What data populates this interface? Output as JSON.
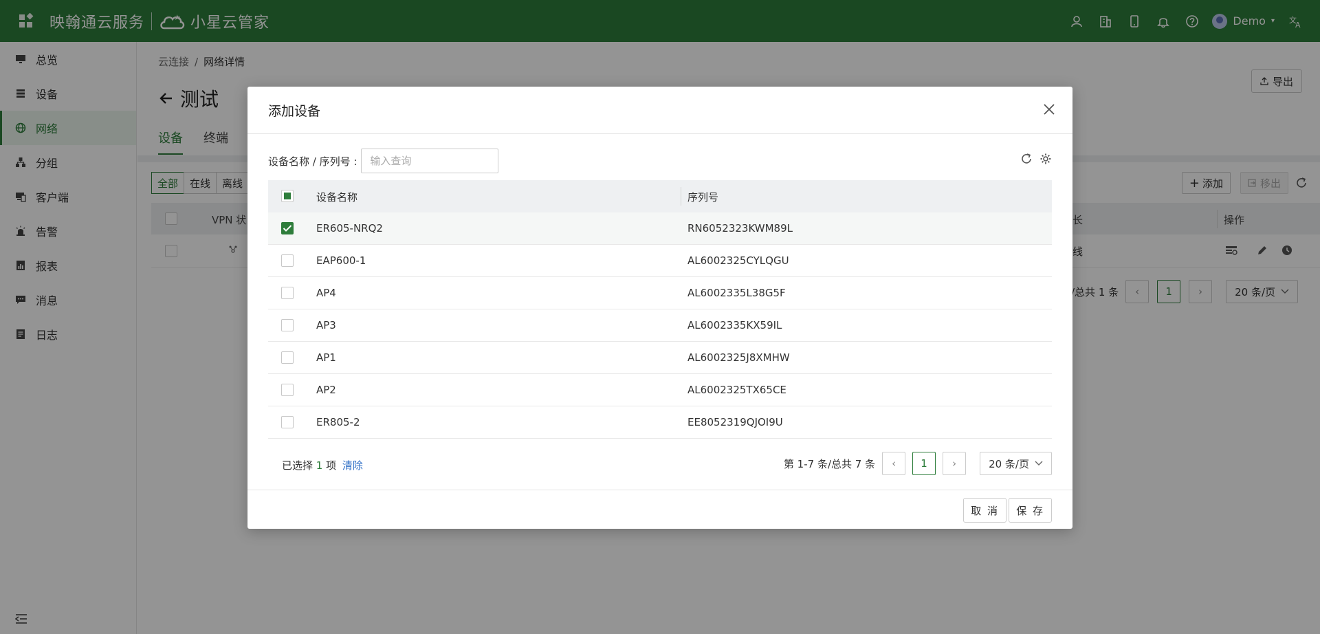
{
  "header": {
    "brand": "映翰通云服务",
    "product": "小星云管家",
    "user": "Demo",
    "icons": [
      "user-icon",
      "building-icon",
      "mobile-icon",
      "bell-icon",
      "help-icon",
      "translate-icon"
    ],
    "bg_color": "#2e7d3b"
  },
  "sidebar": {
    "items": [
      {
        "label": "总览",
        "icon": "monitor-icon"
      },
      {
        "label": "设备",
        "icon": "server-icon"
      },
      {
        "label": "网络",
        "icon": "globe-icon",
        "active": true
      },
      {
        "label": "分组",
        "icon": "hierarchy-icon"
      },
      {
        "label": "客户端",
        "icon": "client-icon"
      },
      {
        "label": "告警",
        "icon": "alarm-icon"
      },
      {
        "label": "报表",
        "icon": "report-icon"
      },
      {
        "label": "消息",
        "icon": "message-icon"
      },
      {
        "label": "日志",
        "icon": "log-icon"
      }
    ]
  },
  "main": {
    "breadcrumb": [
      "云连接",
      "网络详情"
    ],
    "title": "测试",
    "export_label": "导出",
    "tabs": [
      "设备",
      "终端"
    ],
    "filters": [
      "全部",
      "在线",
      "离线"
    ],
    "add_label": "添加",
    "remove_label": "移出",
    "table_headers": {
      "vpn": "VPN 状",
      "duration": "长",
      "actions": "操作"
    },
    "row_status": "线",
    "pager": {
      "summary": "/总共 1 条",
      "page": "1",
      "size": "20 条/页"
    }
  },
  "modal": {
    "title": "添加设备",
    "search_label": "设备名称 / 序列号 :",
    "search_placeholder": "输入查询",
    "columns": [
      "设备名称",
      "序列号"
    ],
    "rows": [
      {
        "name": "ER605-NRQ2",
        "serial": "RN6052323KWM89L",
        "checked": true
      },
      {
        "name": "EAP600-1",
        "serial": "AL6002325CYLQGU",
        "checked": false
      },
      {
        "name": "AP4",
        "serial": "AL6002335L38G5F",
        "checked": false
      },
      {
        "name": "AP3",
        "serial": "AL6002335KX59IL",
        "checked": false
      },
      {
        "name": "AP1",
        "serial": "AL6002325J8XMHW",
        "checked": false
      },
      {
        "name": "AP2",
        "serial": "AL6002325TX65CE",
        "checked": false
      },
      {
        "name": "ER805-2",
        "serial": "EE8052319QJOI9U",
        "checked": false
      }
    ],
    "selection": {
      "prefix": "已选择",
      "count": "1",
      "suffix": "项",
      "clear": "清除"
    },
    "pager": {
      "summary": "第 1-7 条/总共 7 条",
      "page": "1",
      "size": "20 条/页"
    },
    "cancel_label": "取 消",
    "save_label": "保 存"
  }
}
